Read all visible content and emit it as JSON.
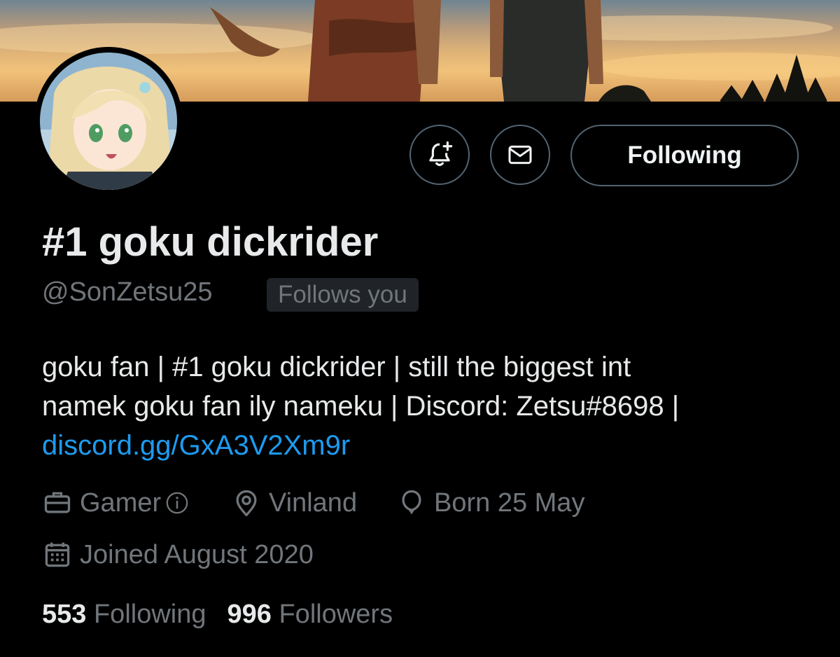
{
  "profile": {
    "display_name": "#1 goku dickrider",
    "handle": "@SonZetsu25",
    "follows_you_badge": "Follows you",
    "bio": {
      "line1": "goku fan | #1 goku dickrider | still the biggest int",
      "line2": "namek goku fan ily nameku | Discord: Zetsu#8698 |",
      "link": "discord.gg/GxA3V2Xm9r"
    }
  },
  "actions": {
    "notify_icon": "bell-plus-icon",
    "message_icon": "envelope-icon",
    "following_label": "Following"
  },
  "meta": {
    "profession": "Gamer",
    "profession_icon": "briefcase-icon",
    "profession_info_icon": "info-icon",
    "location": "Vinland",
    "location_icon": "location-pin-icon",
    "birthday": "Born 25 May",
    "birthday_icon": "balloon-icon",
    "joined": "Joined August 2020",
    "joined_icon": "calendar-icon"
  },
  "stats": {
    "following_count": "553",
    "following_label": "Following",
    "followers_count": "996",
    "followers_label": "Followers"
  },
  "colors": {
    "background": "#000000",
    "primary_text": "#e7e9ea",
    "secondary_text": "#71767b",
    "link": "#1d9bf0",
    "button_border": "#536471",
    "badge_background": "#202327"
  }
}
